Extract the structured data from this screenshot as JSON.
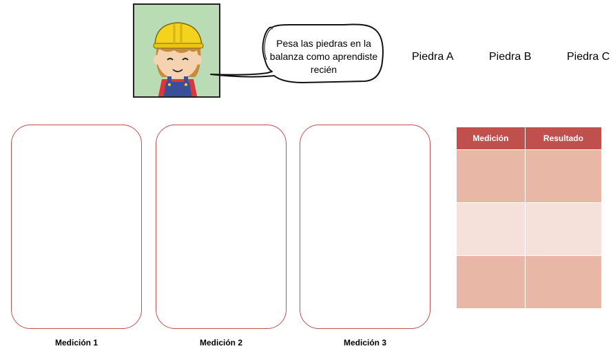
{
  "instruction": {
    "avatar_icon": "construction-worker-icon",
    "bubble_text": "Pesa las piedras en la balanza como aprendiste recién"
  },
  "stones": [
    "Piedra A",
    "Piedra B",
    "Piedra C"
  ],
  "measurement_boxes": [
    "Medición 1",
    "Medición 2",
    "Medición 3"
  ],
  "table": {
    "headers": [
      "Medición",
      "Resultado"
    ],
    "rows": [
      [
        "",
        ""
      ],
      [
        "",
        ""
      ],
      [
        "",
        ""
      ]
    ]
  },
  "colors": {
    "accent": "#c0504d",
    "row_dark": "#e8b7a5",
    "row_light": "#f5e1d9",
    "avatar_bg": "#b9dcb5"
  }
}
